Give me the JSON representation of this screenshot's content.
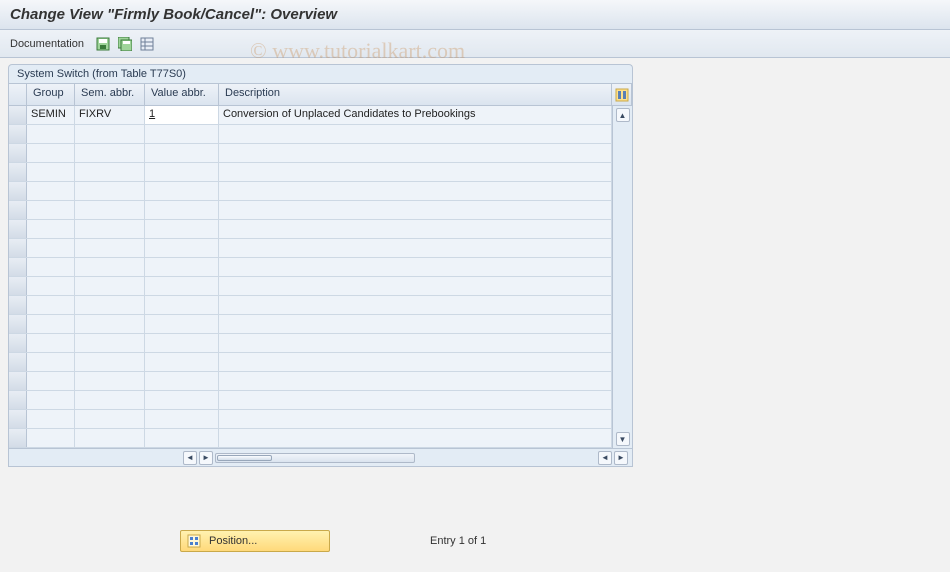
{
  "header": {
    "title": "Change View \"Firmly Book/Cancel\": Overview"
  },
  "toolbar": {
    "documentation_label": "Documentation"
  },
  "watermark": "© www.tutorialkart.com",
  "panel": {
    "title": "System Switch (from Table T77S0)",
    "columns": {
      "group": "Group",
      "sem": "Sem. abbr.",
      "val": "Value abbr.",
      "desc": "Description"
    },
    "rows": [
      {
        "group": "SEMIN",
        "sem": "FIXRV",
        "val": "1",
        "desc": "Conversion of Unplaced Candidates to Prebookings"
      }
    ]
  },
  "footer": {
    "position_label": "Position...",
    "entry_text": "Entry 1 of 1"
  }
}
